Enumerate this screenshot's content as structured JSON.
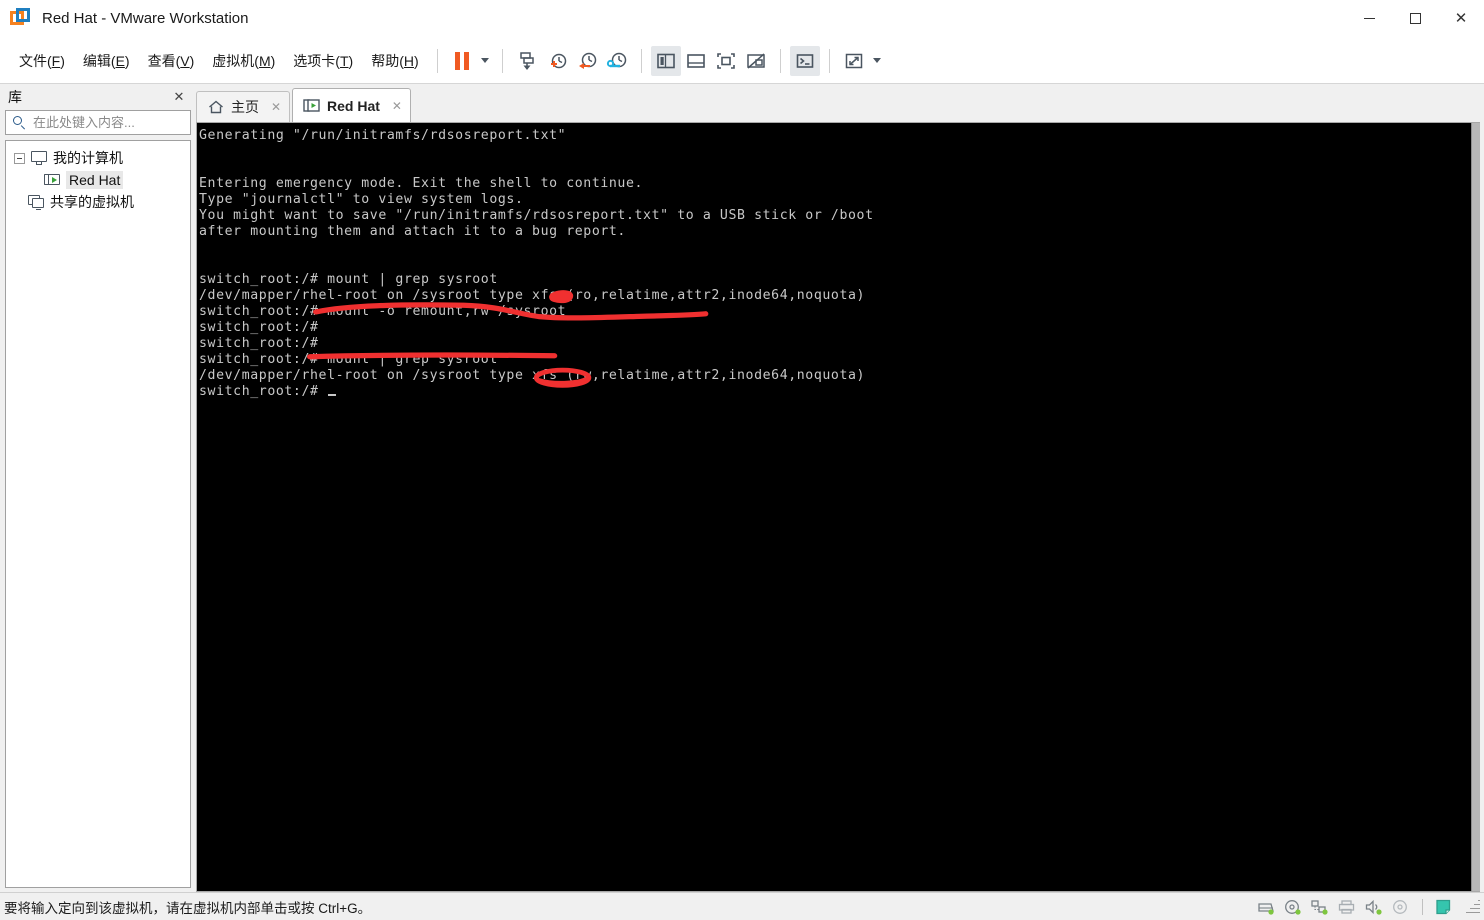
{
  "window": {
    "title": "Red Hat - VMware Workstation",
    "app_icon": "vmware-logo-icon",
    "minimize_label": "–",
    "maximize_label": "☐",
    "close_label": "✕"
  },
  "menu": {
    "items": [
      {
        "name": "file",
        "pre": "文件(",
        "key": "F",
        "post": ")"
      },
      {
        "name": "edit",
        "pre": "编辑(",
        "key": "E",
        "post": ")"
      },
      {
        "name": "view",
        "pre": "查看(",
        "key": "V",
        "post": ")"
      },
      {
        "name": "vm",
        "pre": "虚拟机(",
        "key": "M",
        "post": ")"
      },
      {
        "name": "tabs",
        "pre": "选项卡(",
        "key": "T",
        "post": ")"
      },
      {
        "name": "help",
        "pre": "帮助(",
        "key": "H",
        "post": ")"
      }
    ]
  },
  "toolbar": {
    "buttons": [
      {
        "name": "suspend-button",
        "icon": "pause-icon",
        "active": false
      },
      {
        "name": "power-dropdown",
        "icon": "chevron-down-icon",
        "active": false
      },
      {
        "name": "send-ctrl-alt-del-button",
        "icon": "send-key-icon",
        "active": false
      },
      {
        "name": "take-snapshot-button",
        "icon": "snapshot-add-icon",
        "active": false
      },
      {
        "name": "revert-snapshot-button",
        "icon": "snapshot-revert-icon",
        "active": false
      },
      {
        "name": "snapshot-manager-button",
        "icon": "snapshot-manage-icon",
        "active": false
      },
      {
        "name": "toggle-library-button",
        "icon": "sidebar-panel-icon",
        "active": true
      },
      {
        "name": "toggle-thumbnail-bar-button",
        "icon": "bottom-panel-icon",
        "active": false
      },
      {
        "name": "fit-guest-button",
        "icon": "fit-window-icon",
        "active": false
      },
      {
        "name": "autofit-off-button",
        "icon": "autofit-disabled-icon",
        "active": false
      },
      {
        "name": "console-view-button",
        "icon": "terminal-icon",
        "active": true
      },
      {
        "name": "fullscreen-button",
        "icon": "fullscreen-icon",
        "active": false
      },
      {
        "name": "fullscreen-dropdown",
        "icon": "chevron-down-icon",
        "active": false
      }
    ]
  },
  "sidebar": {
    "title": "库",
    "close_label": "✕",
    "search": {
      "placeholder": "在此处键入内容...",
      "value": "",
      "icon": "search-icon",
      "dropdown_icon": "chevron-down-icon"
    },
    "tree": [
      {
        "name": "my-computer",
        "label": "我的计算机",
        "icon": "monitor-icon",
        "level": 0,
        "expanded": true,
        "selected": false
      },
      {
        "name": "vm-red-hat",
        "label": "Red Hat",
        "icon": "vm-running-icon",
        "level": 1,
        "expanded": false,
        "selected": true
      },
      {
        "name": "shared-vms",
        "label": "共享的虚拟机",
        "icon": "shared-vm-icon",
        "level": 0,
        "expanded": false,
        "selected": false
      }
    ]
  },
  "tabs": [
    {
      "name": "tab-home",
      "label": "主页",
      "icon": "home-icon",
      "active": false,
      "close_label": "✕"
    },
    {
      "name": "tab-red-hat",
      "label": "Red Hat",
      "icon": "vm-running-icon",
      "active": true,
      "close_label": "✕"
    }
  ],
  "terminal": {
    "background": "#000000",
    "foreground": "#c8c8c8",
    "lines": [
      "Generating \"/run/initramfs/rdsosreport.txt\"",
      "",
      "",
      "Entering emergency mode. Exit the shell to continue.",
      "Type \"journalctl\" to view system logs.",
      "You might want to save \"/run/initramfs/rdsosreport.txt\" to a USB stick or /boot",
      "after mounting them and attach it to a bug report.",
      "",
      "",
      "switch_root:/# mount | grep sysroot",
      "/dev/mapper/rhel-root on /sysroot type xfs (ro,relatime,attr2,inode64,noquota)",
      "switch_root:/# mount -o remount,rw /sysroot",
      "switch_root:/#",
      "switch_root:/#",
      "switch_root:/# mount | grep sysroot",
      "/dev/mapper/rhel-root on /sysroot type xfs (rw,relatime,attr2,inode64,noquota)",
      "switch_root:/# "
    ],
    "cursor_line_index": 16
  },
  "annotations": {
    "color": "#f03030",
    "marks": [
      {
        "name": "underline-remount-command",
        "type": "freehand-underline"
      },
      {
        "name": "dot-mark-after-remount",
        "type": "blob"
      },
      {
        "name": "underline-mount-grep-command",
        "type": "straight-underline"
      },
      {
        "name": "ellipse-rw-flag",
        "type": "ellipse"
      }
    ]
  },
  "statusbar": {
    "message": "要将输入定向到该虚拟机，请在虚拟机内部单击或按 Ctrl+G。",
    "icons": [
      {
        "name": "hard-disk-status-icon",
        "connected": true
      },
      {
        "name": "cd-dvd-status-icon",
        "connected": true
      },
      {
        "name": "network-adapter-status-icon",
        "connected": true
      },
      {
        "name": "printer-status-icon",
        "connected": false
      },
      {
        "name": "sound-card-status-icon",
        "connected": true
      },
      {
        "name": "floppy-status-icon",
        "connected": false
      },
      {
        "name": "message-log-icon",
        "connected": false
      }
    ],
    "grip_icon": "resize-grip-icon"
  }
}
